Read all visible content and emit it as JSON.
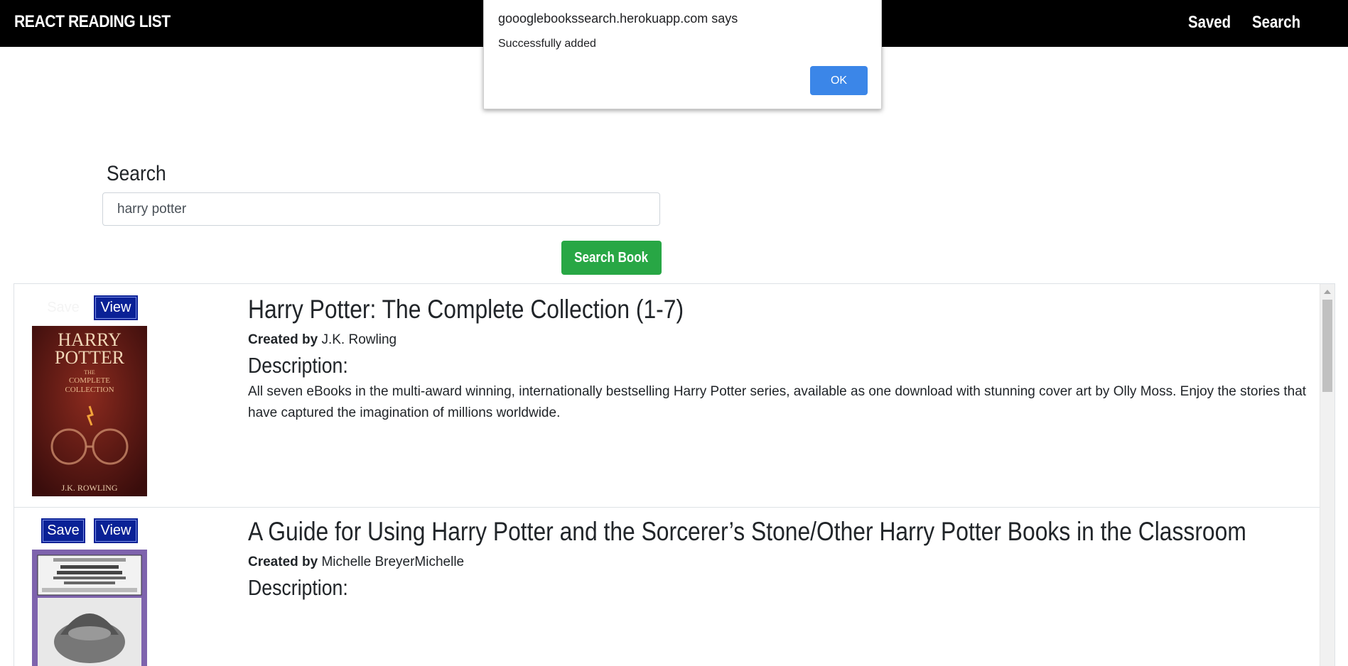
{
  "navbar": {
    "brand": "REACT READING LIST",
    "links": [
      "Saved",
      "Search"
    ]
  },
  "alert": {
    "title": "goooglebookssearch.herokuapp.com says",
    "message": "Successfully added",
    "ok_label": "OK"
  },
  "search": {
    "label": "Search",
    "value": "harry potter",
    "button_label": "Search Book"
  },
  "books": [
    {
      "save_label": "Save",
      "view_label": "View",
      "title": "Harry Potter: The Complete Collection (1-7)",
      "created_by_label": "Created by",
      "author": "J.K. Rowling",
      "description_label": "Description:",
      "description": "All seven eBooks in the multi-award winning, internationally bestselling Harry Potter series, available as one download with stunning cover art by Olly Moss. Enjoy the stories that have captured the imagination of millions worldwide.",
      "cover": {
        "line1": "HARRY",
        "line2": "POTTER",
        "sub1": "THE",
        "sub2": "COMPLETE",
        "sub3": "COLLECTION",
        "author": "J.K. ROWLING"
      }
    },
    {
      "save_label": "Save",
      "view_label": "View",
      "title": "A Guide for Using Harry Potter and the Sorcerer’s Stone/Other Harry Potter Books in the Classroom",
      "created_by_label": "Created by",
      "author": "Michelle BreyerMichelle",
      "description_label": "Description:",
      "description": ""
    }
  ]
}
